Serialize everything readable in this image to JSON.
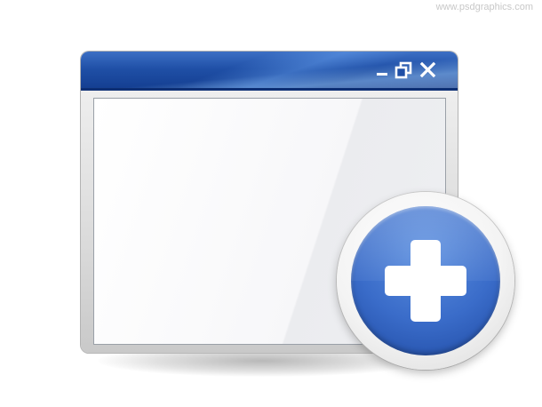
{
  "watermark": {
    "text": "www.psdgraphics.com"
  },
  "window": {
    "controls": {
      "minimize_icon": "minimize-icon",
      "restore_icon": "restore-icon",
      "close_icon": "close-icon"
    },
    "colors": {
      "titlebar": "#1f4fa6",
      "content": "#f7f8fa"
    }
  },
  "badge": {
    "icon": "plus-icon",
    "color": "#3a6cc9"
  }
}
